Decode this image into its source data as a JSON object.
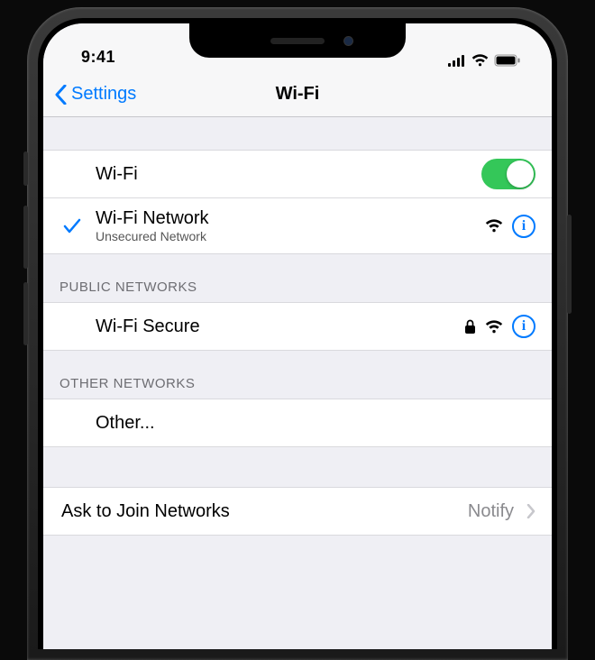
{
  "status": {
    "time": "9:41"
  },
  "nav": {
    "back": "Settings",
    "title": "Wi-Fi"
  },
  "wifi_toggle": {
    "label": "Wi-Fi",
    "on": true
  },
  "current_network": {
    "name": "Wi-Fi Network",
    "subtitle": "Unsecured Network"
  },
  "sections": {
    "public": {
      "header": "PUBLIC NETWORKS",
      "items": [
        {
          "name": "Wi-Fi Secure",
          "locked": true
        }
      ]
    },
    "other": {
      "header": "OTHER NETWORKS",
      "other_label": "Other..."
    }
  },
  "ask_to_join": {
    "label": "Ask to Join Networks",
    "value": "Notify"
  }
}
